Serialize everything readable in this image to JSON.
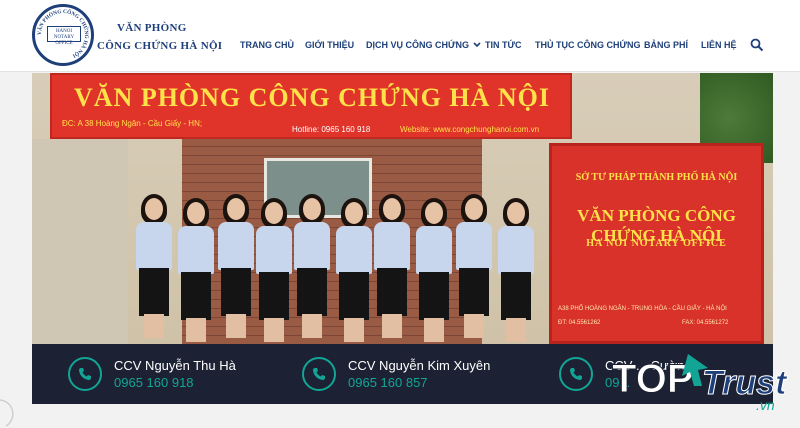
{
  "header": {
    "brand_line1": "VĂN PHÒNG",
    "brand_line2": "CÔNG CHỨNG HÀ NỘI",
    "logo": {
      "ring_text": "VĂN PHÒNG CÔNG CHỨNG HÀ NỘI",
      "center_text": "HANOI NOTARY OFFICE"
    }
  },
  "nav": {
    "items": [
      {
        "label": "TRANG CHỦ",
        "dropdown": false
      },
      {
        "label": "GIỚI THIỆU",
        "dropdown": false
      },
      {
        "label": "DỊCH VỤ CÔNG CHỨNG",
        "dropdown": true
      },
      {
        "label": "TIN TỨC",
        "dropdown": false
      },
      {
        "label": "THỦ TỤC CÔNG CHỨNG",
        "dropdown": false
      },
      {
        "label": "BẢNG PHÍ",
        "dropdown": false
      },
      {
        "label": "LIÊN HỆ",
        "dropdown": false
      }
    ],
    "search_icon": "search-icon"
  },
  "hero": {
    "sign_title": "VĂN PHÒNG CÔNG CHỨNG HÀ NỘI",
    "sign_address": "ĐC: A 38 Hoàng Ngân - Cầu Giấy - HN;",
    "sign_hotline": "Hotline: 0965 160 918",
    "sign_website": "Website: www.congchunghanoi.com.vn",
    "right_sign_line1": "SỞ TƯ PHÁP THÀNH PHỐ HÀ NỘI",
    "right_sign_line2": "VĂN PHÒNG CÔNG CHỨNG HÀ NỘI",
    "right_sign_line3": "HA NOI NOTARY OFFICE",
    "right_sign_line4": "A38 PHỐ HOÀNG NGÂN - TRUNG HÒA - CẦU GIẤY - HÀ NỘI",
    "right_sign_line5": "ĐT: 04.5561262",
    "right_sign_line6": "FAX: 04.5561272"
  },
  "contacts": [
    {
      "name": "CCV Nguyễn Thu Hà",
      "phone": "0965 160 918",
      "icon": "phone-icon"
    },
    {
      "name": "CCV Nguyễn Kim Xuyên",
      "phone": "0965 160 857",
      "icon": "phone-icon"
    },
    {
      "name": "CCV ... Cường",
      "phone": "09...",
      "icon": "phone-icon"
    }
  ],
  "watermark": {
    "text_top": "TOP",
    "text_trust": "Trust",
    "text_vn": ".vn"
  },
  "colors": {
    "brand_blue": "#1e3f7a",
    "accent_teal": "#12a596",
    "bar_dark": "#1c2233",
    "sign_red": "#e0332a",
    "sign_yellow": "#ffe24a"
  }
}
